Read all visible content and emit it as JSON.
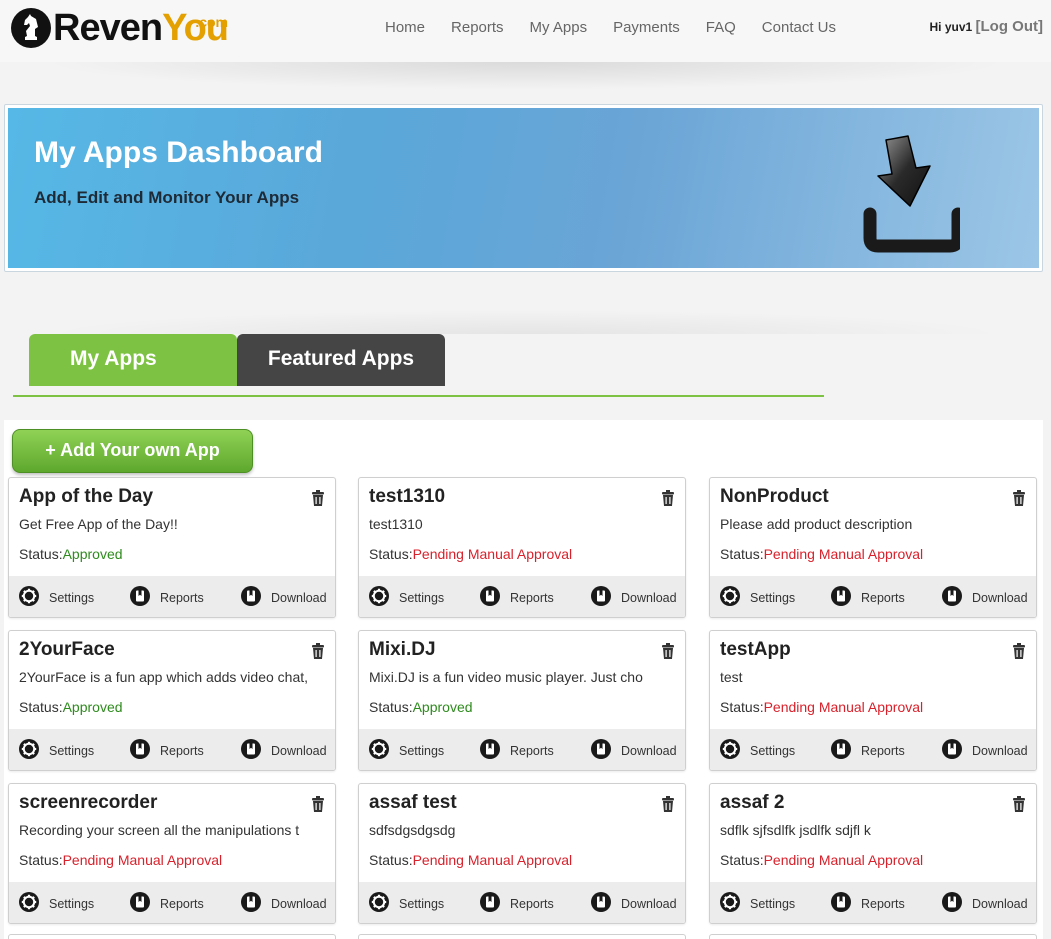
{
  "brand": {
    "name_part1": "Reven",
    "name_part2": "You",
    "tld": ".com"
  },
  "nav": [
    "Home",
    "Reports",
    "My Apps",
    "Payments",
    "FAQ",
    "Contact Us"
  ],
  "user": {
    "greeting": "Hi yuv1",
    "logout_label": "[Log Out]"
  },
  "banner": {
    "title": "My Apps Dashboard",
    "subtitle": "Add, Edit and Monitor Your Apps",
    "icon": "download-icon"
  },
  "tabs": [
    {
      "label": "My Apps",
      "active": true
    },
    {
      "label": "Featured Apps",
      "active": false
    }
  ],
  "add_button": {
    "label": "+ Add Your own App"
  },
  "status_label": "Status:",
  "actions": {
    "settings": "Settings",
    "reports": "Reports",
    "download": "Download"
  },
  "colors": {
    "approved": "#2e8b1d",
    "pending": "#d8212b",
    "tab_active": "#7dc242",
    "tab_inactive": "#454545"
  },
  "apps": [
    {
      "name": "App of the Day",
      "description": "Get Free App of the Day!!",
      "status": "Approved"
    },
    {
      "name": "test1310",
      "description": "test1310",
      "status": "Pending Manual Approval"
    },
    {
      "name": "NonProduct",
      "description": "Please add product description",
      "status": "Pending Manual Approval"
    },
    {
      "name": "2YourFace",
      "description": "2YourFace is a fun app which adds video chat,",
      "status": "Approved"
    },
    {
      "name": "Mixi.DJ",
      "description": "Mixi.DJ is a fun video music player. Just cho",
      "status": "Approved"
    },
    {
      "name": "testApp",
      "description": "test",
      "status": "Pending Manual Approval"
    },
    {
      "name": "screenrecorder",
      "description": "Recording your screen all the manipulations t",
      "status": "Pending Manual Approval"
    },
    {
      "name": "assaf test",
      "description": "sdfsdgsdgsdg",
      "status": "Pending Manual Approval"
    },
    {
      "name": "assaf 2",
      "description": "sdflk sjfsdlfk jsdlfk sdjfl k",
      "status": "Pending Manual Approval"
    }
  ]
}
